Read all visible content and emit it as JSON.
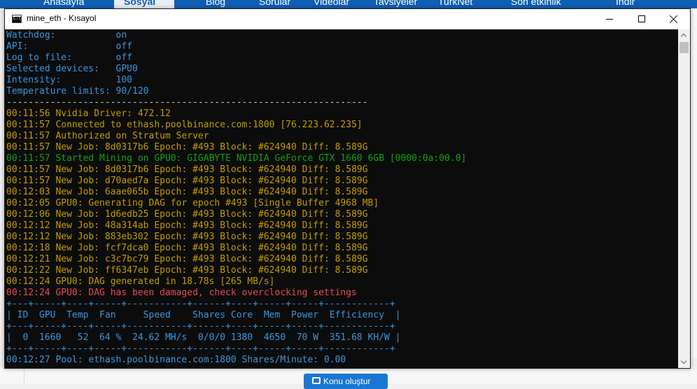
{
  "background": {
    "nav_items": [
      "Anasayfa",
      "Sosyal",
      "Blog",
      "Sorular",
      "Videolar",
      "Tavsiyeler",
      "TurkNet",
      "Son etkinlik",
      "Indir"
    ],
    "button_label": "Konu oluştur"
  },
  "window": {
    "title": "mine_eth - Kısayol",
    "icon": "console-icon",
    "controls": [
      "minimize-icon",
      "maximize-icon",
      "close-icon"
    ]
  },
  "console": {
    "colors": {
      "cyan": "#3a96dd",
      "yellow": "#c19c00",
      "green": "#13a10e",
      "red": "#e74856",
      "background": "#0c0c0c"
    },
    "lines": [
      {
        "text": "Watchdog:           on",
        "color": "cyan"
      },
      {
        "text": "API:                off",
        "color": "cyan"
      },
      {
        "text": "Log to file:        off",
        "color": "cyan"
      },
      {
        "text": "Selected devices:   GPU0",
        "color": "cyan"
      },
      {
        "text": "Intensity:          100",
        "color": "cyan"
      },
      {
        "text": "Temperature limits: 90/120",
        "color": "cyan"
      },
      {
        "text": "------------------------------------------------------------------",
        "color": "gray"
      },
      {
        "text": "00:11:56 Nvidia Driver: 472.12",
        "color": "yellow"
      },
      {
        "text": "00:11:57 Connected to ethash.poolbinance.com:1800 [76.223.62.235]",
        "color": "yellow"
      },
      {
        "text": "00:11:57 Authorized on Stratum Server",
        "color": "yellow"
      },
      {
        "text": "00:11:57 New Job: 8d0317b6 Epoch: #493 Block: #624940 Diff: 8.589G",
        "color": "yellow"
      },
      {
        "text": "00:11:57 Started Mining on GPU0: GIGABYTE NVIDIA GeForce GTX 1660 6GB [0000:0a:00.0]",
        "color": "green"
      },
      {
        "text": "00:11:57 New Job: 8d0317b6 Epoch: #493 Block: #624940 Diff: 8.589G",
        "color": "yellow"
      },
      {
        "text": "00:11:57 New Job: d70aed7a Epoch: #493 Block: #624940 Diff: 8.589G",
        "color": "yellow"
      },
      {
        "text": "00:12:03 New Job: 6aae065b Epoch: #493 Block: #624940 Diff: 8.589G",
        "color": "yellow"
      },
      {
        "text": "00:12:05 GPU0: Generating DAG for epoch #493 [Single Buffer 4968 MB]",
        "color": "yellow"
      },
      {
        "text": "00:12:06 New Job: 1d6edb25 Epoch: #493 Block: #624940 Diff: 8.589G",
        "color": "yellow"
      },
      {
        "text": "00:12:12 New Job: 48a314ab Epoch: #493 Block: #624940 Diff: 8.589G",
        "color": "yellow"
      },
      {
        "text": "00:12:12 New Job: 883eb302 Epoch: #493 Block: #624940 Diff: 8.589G",
        "color": "yellow"
      },
      {
        "text": "00:12:18 New Job: fcf7dca0 Epoch: #493 Block: #624940 Diff: 8.589G",
        "color": "yellow"
      },
      {
        "text": "00:12:21 New Job: c3c7bc79 Epoch: #493 Block: #624940 Diff: 8.589G",
        "color": "yellow"
      },
      {
        "text": "00:12:22 New Job: ff6347eb Epoch: #493 Block: #624940 Diff: 8.589G",
        "color": "yellow"
      },
      {
        "text": "00:12:24 GPU0: DAG generated in 18.78s [265 MB/s]",
        "color": "yellow"
      },
      {
        "text": "00:12:24 GPU0: DAG has been damaged, check overclocking settings",
        "color": "red"
      },
      {
        "text": "+---+-----+----+-----+-----------+------+----+-----+-----+------------+",
        "color": "cyan"
      },
      {
        "text": "| ID  GPU  Temp  Fan     Speed    Shares Core  Mem  Power  Efficiency  |",
        "color": "cyan"
      },
      {
        "text": "+---+-----+----+-----+-----------+------+----+-----+-----+------------+",
        "color": "cyan"
      },
      {
        "text": "|  0  1660   52  64 %  24.62 MH/s  0/0/0 1380  4650  70 W  351.68 KH/W |",
        "color": "cyan"
      },
      {
        "text": "+---+-----+----+-----+-----------+------+----+-----+-----+------------+",
        "color": "cyan"
      },
      {
        "text": "00:12:27 Pool: ethash.poolbinance.com:1800 Shares/Minute: 0.00",
        "color": "cyan"
      }
    ]
  }
}
